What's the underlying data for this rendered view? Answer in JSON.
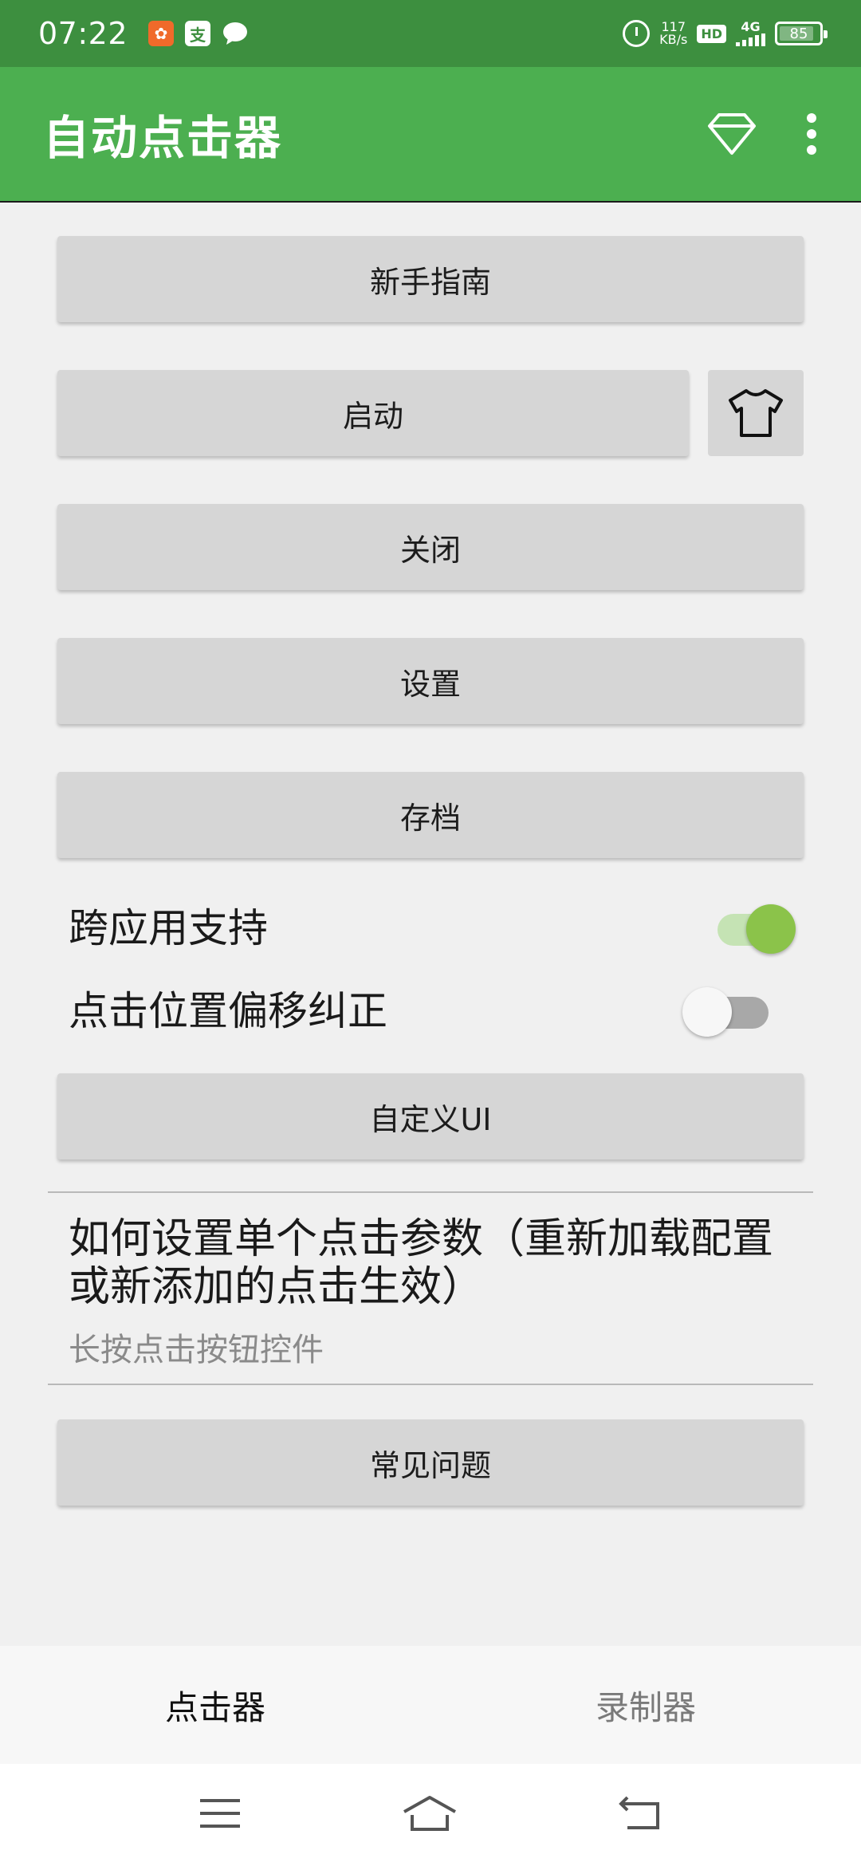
{
  "status_bar": {
    "time": "07:22",
    "net_speed_value": "117",
    "net_speed_unit": "KB/s",
    "hd": "HD",
    "signal": "4G",
    "battery": "85",
    "notif_icons": [
      "kuaishou-icon",
      "alipay-icon",
      "chat-bubble-icon"
    ]
  },
  "app_bar": {
    "title": "自动点击器",
    "actions": [
      "diamond-icon",
      "more-vert-icon"
    ]
  },
  "buttons": {
    "guide": "新手指南",
    "start": "启动",
    "close": "关闭",
    "settings": "设置",
    "archive": "存档",
    "custom_ui": "自定义UI",
    "faq": "常见问题"
  },
  "switches": {
    "cross_app": {
      "label": "跨应用支持",
      "state": "on"
    },
    "offset_fix": {
      "label": "点击位置偏移纠正",
      "state": "off"
    }
  },
  "info": {
    "title": "如何设置单个点击参数（重新加载配置或新添加的点击生效）",
    "subtitle": "长按点击按钮控件"
  },
  "tabs": [
    {
      "label": "点击器",
      "active": true
    },
    {
      "label": "录制器",
      "active": false
    }
  ],
  "colors": {
    "status_bar": "#3d8f3f",
    "app_bar": "#4caf50",
    "switch_on": "#8bc34a",
    "button_bg": "#d6d6d6"
  }
}
